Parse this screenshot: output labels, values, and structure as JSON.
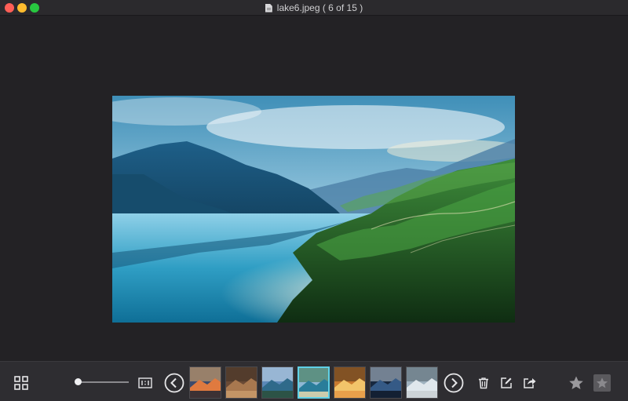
{
  "window": {
    "title": "lake6.jpeg ( 6 of 15 )"
  },
  "icons": {
    "close": "traffic-light-red",
    "minimize": "traffic-light-yellow",
    "maximize": "traffic-light-green",
    "document": "document-icon",
    "grid": "grid-icon",
    "actual_size": "one-to-one-icon",
    "prev": "chevron-left-circle-icon",
    "next": "chevron-right-circle-icon",
    "trash": "trash-icon",
    "edit": "edit-icon",
    "share": "share-icon",
    "star": "star-icon",
    "star_box": "star-box-icon"
  },
  "viewer": {
    "current_index": 6,
    "total": 15
  },
  "zoom": {
    "level": 0.05
  },
  "thumbnails": [
    {
      "name": "thumb-1",
      "active": false,
      "palette": [
        "#3d4b6b",
        "#e07a3f",
        "#f4b56a",
        "#1f2533"
      ]
    },
    {
      "name": "thumb-2",
      "active": false,
      "palette": [
        "#6a4a35",
        "#a8784f",
        "#3c2d24",
        "#c89a6a"
      ]
    },
    {
      "name": "thumb-3",
      "active": false,
      "palette": [
        "#5b88b8",
        "#2f6a8a",
        "#d5e4ef",
        "#2b4f3a"
      ]
    },
    {
      "name": "thumb-4",
      "active": true,
      "palette": [
        "#8fb8d4",
        "#2a7d9a",
        "#2d6a33",
        "#e8d9b0"
      ]
    },
    {
      "name": "thumb-5",
      "active": false,
      "palette": [
        "#c97a2f",
        "#f2c46a",
        "#3b2a1a",
        "#e69a45"
      ]
    },
    {
      "name": "thumb-6",
      "active": false,
      "palette": [
        "#17283f",
        "#355a86",
        "#cfd9e6",
        "#0d1624"
      ]
    },
    {
      "name": "thumb-7",
      "active": false,
      "palette": [
        "#9fb2bf",
        "#dfe7ec",
        "#4b5a63",
        "#c9cfd3"
      ]
    }
  ],
  "colors": {
    "active_thumb_border": "#5fd0e6",
    "toolbar_bg": "#2e2d31",
    "canvas_bg": "#232225"
  }
}
